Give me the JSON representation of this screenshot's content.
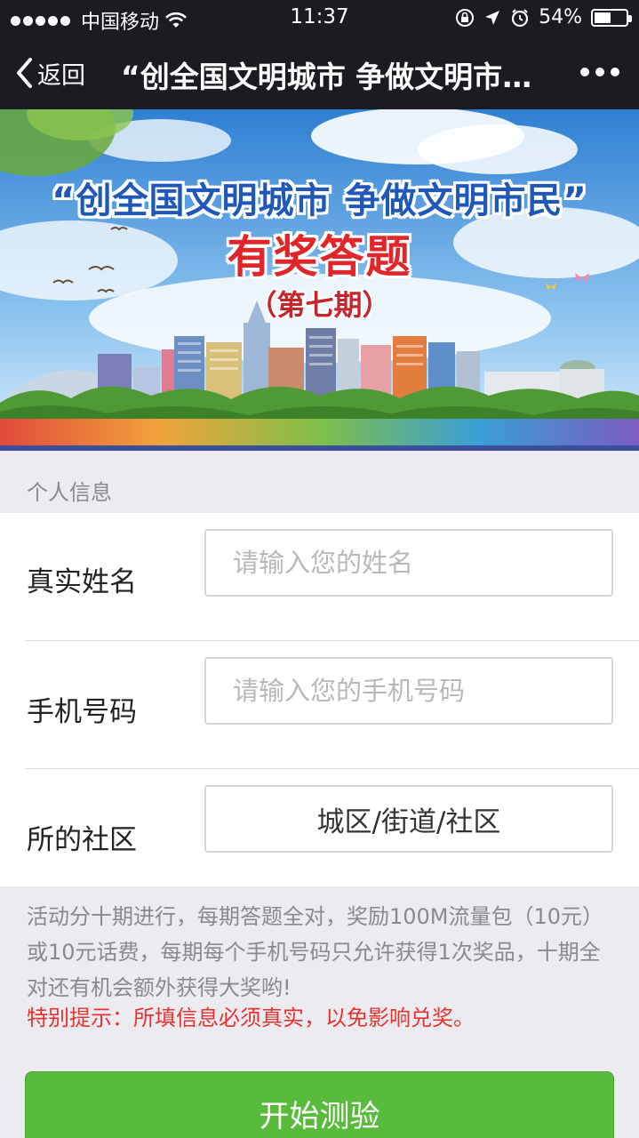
{
  "status_bar": {
    "carrier": "中国移动",
    "time": "11:37",
    "battery_percent": "54%",
    "battery_level": 0.54
  },
  "nav": {
    "back_label": "返回",
    "title": "“创全国文明城市 争做文明市民”有奖答题"
  },
  "banner": {
    "line1": "“创全国文明城市  争做文明市民”",
    "line2": "有奖答题",
    "line3": "（第七期）"
  },
  "section": {
    "title": "个人信息"
  },
  "form": {
    "name_label": "真实姓名",
    "name_placeholder": "请输入您的姓名",
    "phone_label": "手机号码",
    "phone_placeholder": "请输入您的手机号码",
    "community_label": "所的社区",
    "community_value": "城区/街道/社区"
  },
  "notes": {
    "text": "活动分十期进行，每期答题全对，奖励100M流量包（10元）或10元话费，每期每个手机号码只允许获得1次奖品，十期全对还有机会额外获得大奖哟!",
    "warning": "特别提示：所填信息必须真实，以免影响兑奖。"
  },
  "start_button": {
    "label": "开始测验"
  },
  "colors": {
    "bar_bg": "#1b1c21",
    "primary_green": "#58bb3b",
    "warning_red": "#e8322f",
    "banner_blue_text": "#1f58b8",
    "banner_red_text": "#e0262b"
  }
}
